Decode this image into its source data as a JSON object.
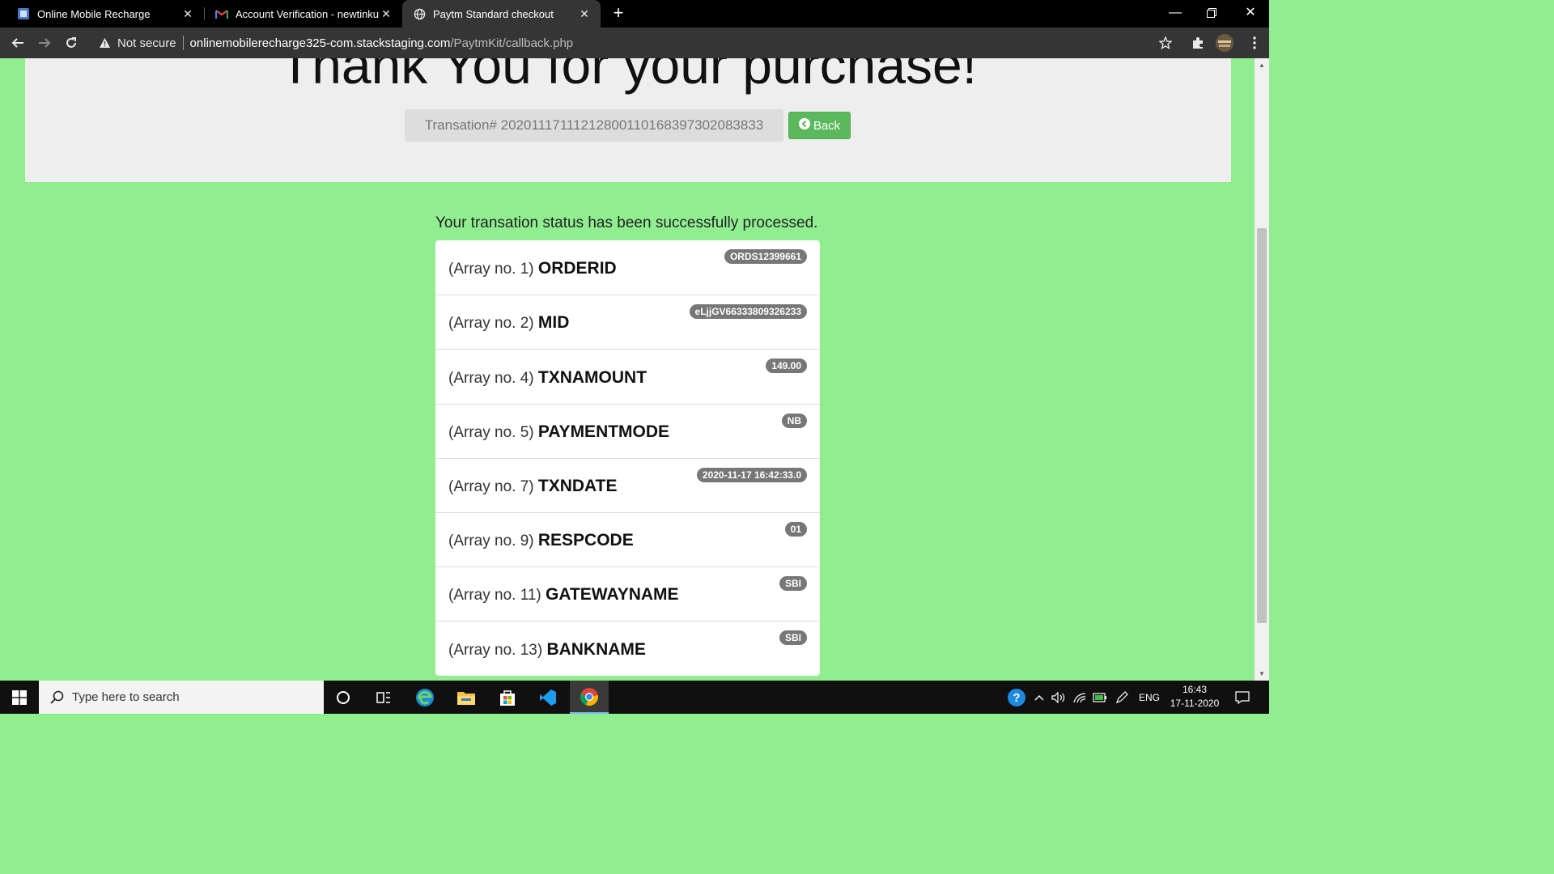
{
  "browser": {
    "tabs": [
      {
        "title": "Online Mobile Recharge",
        "favicon": "site-favicon-icon",
        "active": false
      },
      {
        "title": "Account Verification - newtinkum",
        "favicon": "gmail-icon",
        "active": false
      },
      {
        "title": "Paytm Standard checkout",
        "favicon": "globe-icon",
        "active": true
      }
    ],
    "security_label": "Not secure",
    "url_host": "onlinemobilerecharge325-com.stackstaging.com",
    "url_path": "/PaytmKit/callback.php"
  },
  "page": {
    "heading": "Thank You for your purchase!",
    "transaction_text": "Transation# 20201117111212800110168397302083833",
    "back_label": "Back",
    "status_message": "Your transation status has been successfully processed.",
    "rows": [
      {
        "prefix": "(Array no. 1)",
        "key": "ORDERID",
        "value": "ORDS12399661"
      },
      {
        "prefix": "(Array no. 2)",
        "key": "MID",
        "value": "eLjjGV66333809326233"
      },
      {
        "prefix": "(Array no. 4)",
        "key": "TXNAMOUNT",
        "value": "149.00"
      },
      {
        "prefix": "(Array no. 5)",
        "key": "PAYMENTMODE",
        "value": "NB"
      },
      {
        "prefix": "(Array no. 7)",
        "key": "TXNDATE",
        "value": "2020-11-17 16:42:33.0"
      },
      {
        "prefix": "(Array no. 9)",
        "key": "RESPCODE",
        "value": "01"
      },
      {
        "prefix": "(Array no. 11)",
        "key": "GATEWAYNAME",
        "value": "SBI"
      },
      {
        "prefix": "(Array no. 13)",
        "key": "BANKNAME",
        "value": "SBI"
      }
    ]
  },
  "taskbar": {
    "search_placeholder": "Type here to search",
    "language": "ENG",
    "time": "16:43",
    "date": "17-11-2020"
  },
  "colors": {
    "page_background": "#90ee90",
    "jumbotron": "#eeeeee",
    "back_button": "#5cb85c",
    "badge": "#777777"
  }
}
